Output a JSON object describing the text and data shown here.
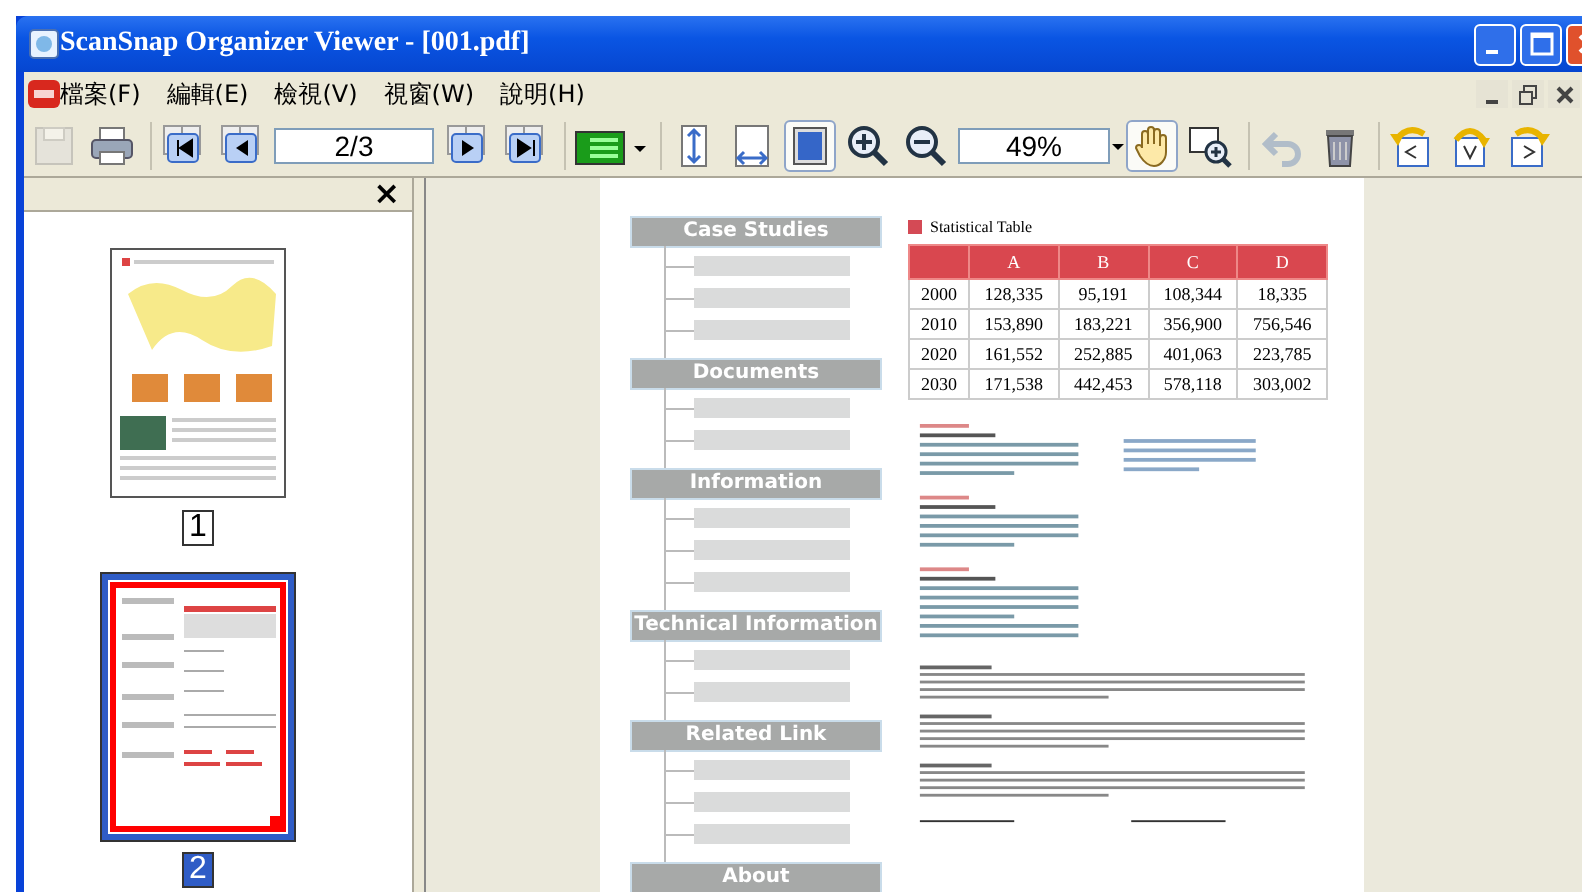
{
  "window": {
    "title": "ScanSnap Organizer Viewer - [001.pdf]"
  },
  "menu": [
    {
      "label": "檔案(F)"
    },
    {
      "label": "編輯(E)"
    },
    {
      "label": "檢視(V)"
    },
    {
      "label": "視窗(W)"
    },
    {
      "label": "說明(H)"
    }
  ],
  "toolbar": [
    {
      "kind": "save",
      "disabled": true,
      "selected": false
    },
    {
      "kind": "print",
      "disabled": false,
      "selected": false
    },
    {
      "kind": "sep"
    },
    {
      "kind": "first",
      "disabled": false,
      "selected": false
    },
    {
      "kind": "prev",
      "disabled": false,
      "selected": false
    },
    {
      "kind": "page_field",
      "value": "2/3"
    },
    {
      "kind": "next",
      "disabled": false,
      "selected": false
    },
    {
      "kind": "last",
      "disabled": false,
      "selected": false
    },
    {
      "kind": "sep"
    },
    {
      "kind": "view_mode",
      "disabled": false,
      "selected": false
    },
    {
      "kind": "sep"
    },
    {
      "kind": "fit_height",
      "disabled": false,
      "selected": false
    },
    {
      "kind": "fit_width",
      "disabled": false,
      "selected": false
    },
    {
      "kind": "fit_page",
      "disabled": false,
      "selected": true
    },
    {
      "kind": "zoom_in",
      "disabled": false,
      "selected": false
    },
    {
      "kind": "zoom_out",
      "disabled": false,
      "selected": false
    },
    {
      "kind": "zoom_field",
      "value": "49%"
    },
    {
      "kind": "hand",
      "disabled": false,
      "selected": true
    },
    {
      "kind": "zoom_rect",
      "disabled": false,
      "selected": false
    },
    {
      "kind": "sep"
    },
    {
      "kind": "undo",
      "disabled": true,
      "selected": false
    },
    {
      "kind": "trash",
      "disabled": false,
      "selected": false
    },
    {
      "kind": "sep"
    },
    {
      "kind": "rotate_left",
      "disabled": false,
      "selected": false
    },
    {
      "kind": "rotate_180",
      "disabled": false,
      "selected": false
    },
    {
      "kind": "rotate_right",
      "disabled": false,
      "selected": false
    }
  ],
  "sidebar": {
    "close": "×",
    "thumbnails": [
      {
        "label": "1",
        "selected": false
      },
      {
        "label": "2",
        "selected": true
      }
    ]
  },
  "document": {
    "nav_headings": [
      "Case Studies",
      "Documents",
      "Information",
      "Technical Information",
      "Related Link",
      "About"
    ],
    "table_title": "Statistical Table",
    "table": {
      "columns": [
        "",
        "A",
        "B",
        "C",
        "D"
      ],
      "rows": [
        [
          "2000",
          "128,335",
          "95,191",
          "108,344",
          "18,335"
        ],
        [
          "2010",
          "153,890",
          "183,221",
          "356,900",
          "756,546"
        ],
        [
          "2020",
          "161,552",
          "252,885",
          "401,063",
          "223,785"
        ],
        [
          "2030",
          "171,538",
          "442,453",
          "578,118",
          "303,002"
        ]
      ]
    }
  }
}
